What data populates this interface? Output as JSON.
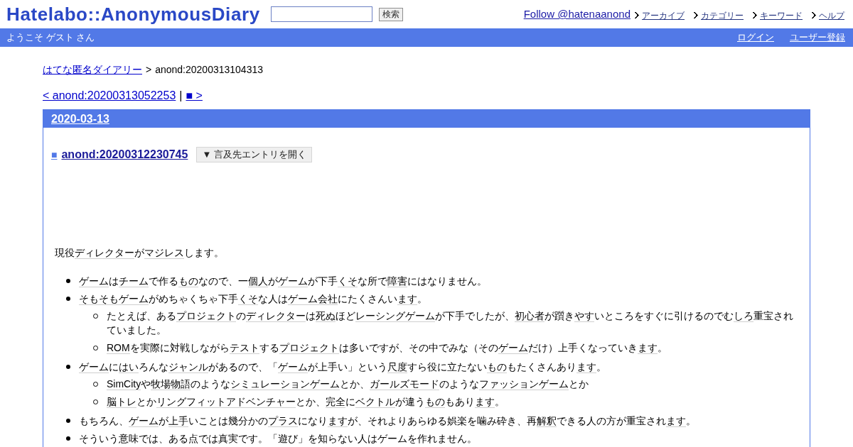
{
  "header": {
    "logo": "Hatelabo::AnonymousDiary",
    "search_button": "検索",
    "follow_link": "Follow @hatenaanond",
    "nav_links": [
      "アーカイブ",
      "カテゴリー",
      "キーワード",
      "ヘルプ"
    ]
  },
  "user_bar": {
    "greeting": "ようこそ ゲスト さん",
    "links": [
      "ログイン",
      "ユーザー登録"
    ]
  },
  "breadcrumb": {
    "link": "はてな匿名ダイアリー",
    "separator": ">",
    "current": "anond:20200313104313"
  },
  "pager": {
    "prev": "< anond:20200313052253",
    "separator": "|",
    "next": "■ >"
  },
  "entry": {
    "date": "2020-03-13",
    "marker": "■",
    "title": "anond:20200312230745",
    "toggle_button": "▼ 言及先エントリを開く",
    "intro": [
      {
        "text": "現役",
        "keyword": false
      },
      {
        "text": "ディレクター",
        "keyword": true
      },
      {
        "text": "が",
        "keyword": false
      },
      {
        "text": "マジレス",
        "keyword": true
      },
      {
        "text": "します。",
        "keyword": false
      }
    ],
    "list": [
      {
        "segments": [
          {
            "text": "ゲーム",
            "keyword": true
          },
          {
            "text": "は",
            "keyword": false
          },
          {
            "text": "チーム",
            "keyword": true
          },
          {
            "text": "で作る",
            "keyword": false
          },
          {
            "text": "もの",
            "keyword": true
          },
          {
            "text": "なので、一",
            "keyword": false
          },
          {
            "text": "個人",
            "keyword": true
          },
          {
            "text": "が",
            "keyword": false
          },
          {
            "text": "ゲーム",
            "keyword": true
          },
          {
            "text": "が下手",
            "keyword": false
          },
          {
            "text": "くそ",
            "keyword": true
          },
          {
            "text": "な所で",
            "keyword": false
          },
          {
            "text": "障害",
            "keyword": true
          },
          {
            "text": "にはなりません。",
            "keyword": false
          }
        ]
      },
      {
        "segments": [
          {
            "text": "そもそも",
            "keyword": true
          },
          {
            "text": "ゲーム",
            "keyword": true
          },
          {
            "text": "がめちゃくちゃ下手",
            "keyword": false
          },
          {
            "text": "くそ",
            "keyword": true
          },
          {
            "text": "な人は",
            "keyword": false
          },
          {
            "text": "ゲーム会社",
            "keyword": true
          },
          {
            "text": "にたくさんい",
            "keyword": false
          },
          {
            "text": "ます",
            "keyword": true
          },
          {
            "text": "。",
            "keyword": false
          }
        ],
        "children": [
          {
            "segments": [
              {
                "text": "たとえば、ある",
                "keyword": false
              },
              {
                "text": "プロジェクト",
                "keyword": true
              },
              {
                "text": "の",
                "keyword": false
              },
              {
                "text": "ディレクター",
                "keyword": true
              },
              {
                "text": "は",
                "keyword": false
              },
              {
                "text": "死ぬ",
                "keyword": true
              },
              {
                "text": "ほど",
                "keyword": false
              },
              {
                "text": "レーシングゲーム",
                "keyword": true
              },
              {
                "text": "が下手でしたが、",
                "keyword": false
              },
              {
                "text": "初心者",
                "keyword": true
              },
              {
                "text": "が躓き",
                "keyword": false
              },
              {
                "text": "やす",
                "keyword": true
              },
              {
                "text": "いところをすぐに引けるのでむ",
                "keyword": false
              },
              {
                "text": "しろ",
                "keyword": true
              },
              {
                "text": "重宝されていました。",
                "keyword": false
              }
            ]
          },
          {
            "segments": [
              {
                "text": "ROM",
                "keyword": true
              },
              {
                "text": "を実際に対戦しながら",
                "keyword": false
              },
              {
                "text": "テスト",
                "keyword": true
              },
              {
                "text": "する",
                "keyword": false
              },
              {
                "text": "プロジェクト",
                "keyword": true
              },
              {
                "text": "は多いですが、その中でみな（その",
                "keyword": false
              },
              {
                "text": "ゲーム",
                "keyword": true
              },
              {
                "text": "だけ）上手くなっていき",
                "keyword": false
              },
              {
                "text": "ます",
                "keyword": true
              },
              {
                "text": "。",
                "keyword": false
              }
            ]
          }
        ]
      },
      {
        "segments": [
          {
            "text": "ゲーム",
            "keyword": true
          },
          {
            "text": "に",
            "keyword": false
          },
          {
            "text": "はい",
            "keyword": true
          },
          {
            "text": "ろんな",
            "keyword": false
          },
          {
            "text": "ジャンル",
            "keyword": true
          },
          {
            "text": "があるので、「",
            "keyword": false
          },
          {
            "text": "ゲーム",
            "keyword": true
          },
          {
            "text": "が上手い」という",
            "keyword": false
          },
          {
            "text": "尺度",
            "keyword": true
          },
          {
            "text": "すら役に立たない",
            "keyword": false
          },
          {
            "text": "もの",
            "keyword": true
          },
          {
            "text": "もたくさんあり",
            "keyword": false
          },
          {
            "text": "ます",
            "keyword": true
          },
          {
            "text": "。",
            "keyword": false
          }
        ],
        "children": [
          {
            "segments": [
              {
                "text": "SimCity",
                "keyword": true
              },
              {
                "text": "や",
                "keyword": false
              },
              {
                "text": "牧場物語",
                "keyword": true
              },
              {
                "text": "のような",
                "keyword": false
              },
              {
                "text": "シミュレーションゲーム",
                "keyword": true
              },
              {
                "text": "とか、",
                "keyword": false
              },
              {
                "text": "ガールズモード",
                "keyword": true
              },
              {
                "text": "のような",
                "keyword": false
              },
              {
                "text": "ファッションゲーム",
                "keyword": true
              },
              {
                "text": "とか",
                "keyword": false
              }
            ]
          },
          {
            "segments": [
              {
                "text": "脳トレ",
                "keyword": true
              },
              {
                "text": "とか",
                "keyword": false
              },
              {
                "text": "リングフィットアドベンチャー",
                "keyword": true
              },
              {
                "text": "とか、",
                "keyword": false
              },
              {
                "text": "完全",
                "keyword": true
              },
              {
                "text": "に",
                "keyword": false
              },
              {
                "text": "ベクトル",
                "keyword": true
              },
              {
                "text": "が違う",
                "keyword": false
              },
              {
                "text": "もの",
                "keyword": true
              },
              {
                "text": "もあり",
                "keyword": false
              },
              {
                "text": "ます",
                "keyword": true
              },
              {
                "text": "。",
                "keyword": false
              }
            ]
          }
        ]
      },
      {
        "segments": [
          {
            "text": "もちろん、",
            "keyword": false
          },
          {
            "text": "ゲーム",
            "keyword": true
          },
          {
            "text": "が",
            "keyword": false
          },
          {
            "text": "上手",
            "keyword": true
          },
          {
            "text": "いことは幾分かの",
            "keyword": false
          },
          {
            "text": "プラス",
            "keyword": true
          },
          {
            "text": "になり",
            "keyword": false
          },
          {
            "text": "ます",
            "keyword": true
          },
          {
            "text": "が、それよりあらゆる娯楽を噛み砕き、再",
            "keyword": false
          },
          {
            "text": "解釈",
            "keyword": true
          },
          {
            "text": "できる人の方が重宝され",
            "keyword": false
          },
          {
            "text": "ます",
            "keyword": true
          },
          {
            "text": "。",
            "keyword": false
          }
        ]
      },
      {
        "segments": [
          {
            "text": "そういう意味では、ある点では真実です。「遊び」を知らない人はゲームを作れません。",
            "keyword": false
          }
        ]
      }
    ]
  }
}
